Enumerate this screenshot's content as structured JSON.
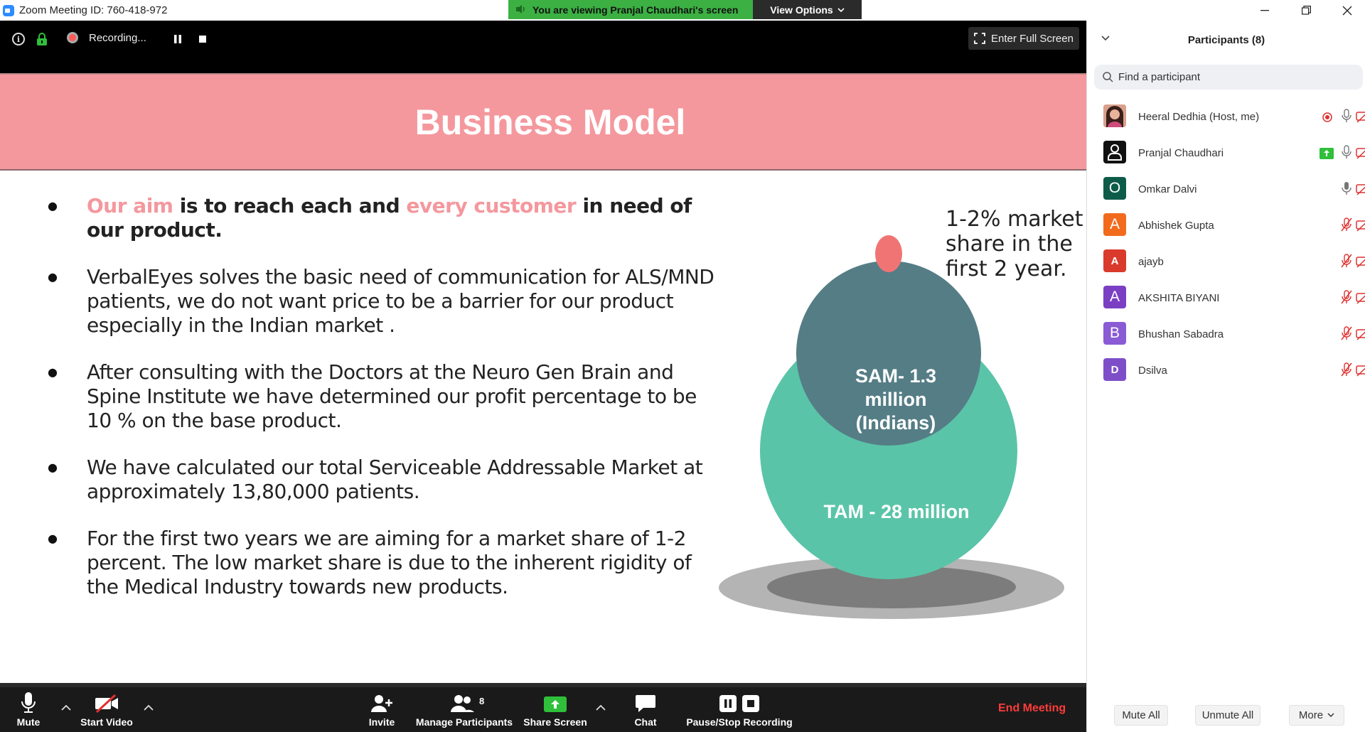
{
  "window": {
    "title": "Zoom Meeting ID: 760-418-972"
  },
  "banner": {
    "viewing_text": "You are viewing Pranjal Chaudhari's screen",
    "view_options": "View Options"
  },
  "topbar": {
    "recording_text": "Recording...",
    "fullscreen_label": "Enter Full Screen"
  },
  "slide": {
    "title": "Business Model",
    "bullet1": {
      "pink_a": "Our aim",
      "text_a": " is to reach each and ",
      "pink_b": "every customer",
      "text_b": " in need of our product."
    },
    "bullet2": "VerbalEyes solves the basic need of communication for ALS/MND patients, we do not want price to be a barrier for our product especially in the Indian market .",
    "bullet3": "After consulting with the Doctors at the Neuro Gen Brain and Spine Institute we have determined our profit percentage to be 10 % on the base product.",
    "bullet4": "We have calculated our total Serviceable Addressable Market at approximately 13,80,000 patients.",
    "bullet5": "For the first two years we are aiming for a market share of 1-2 percent. The low market share is due to the inherent rigidity of the Medical Industry towards new products.",
    "venn": {
      "market_share": "1-2% market share in the first 2 year.",
      "sam_line1": "SAM- 1.3",
      "sam_line2": "million",
      "sam_line3": "(Indians)",
      "tam": "TAM - 28 million"
    }
  },
  "toolbar": {
    "mute": "Mute",
    "start_video": "Start Video",
    "invite": "Invite",
    "manage_participants": "Manage Participants",
    "participant_count": "8",
    "share_screen": "Share Screen",
    "chat": "Chat",
    "pause_stop_recording": "Pause/Stop Recording",
    "end_meeting": "End Meeting"
  },
  "participants_panel": {
    "title": "Participants (8)",
    "search_placeholder": "Find a participant",
    "participants": [
      {
        "name": "Heeral Dedhia (Host, me)",
        "avatar": "photo",
        "color": "#c98a7a",
        "recording": true,
        "mic": "on",
        "video": "off"
      },
      {
        "name": "Pranjal Chaudhari",
        "avatar": "person-icon",
        "color": "#111111",
        "sharing": true,
        "mic": "on",
        "video": "off"
      },
      {
        "name": "Omkar Dalvi",
        "avatar": "O",
        "color": "#0d5c4a",
        "mic": "on",
        "video": "off"
      },
      {
        "name": "Abhishek Gupta",
        "avatar": "A",
        "color": "#f26b1d",
        "mic": "muted",
        "video": "off"
      },
      {
        "name": "ajayb",
        "avatar": "A",
        "color": "#d93a2b",
        "mic": "muted",
        "video": "off"
      },
      {
        "name": "AKSHITA BIYANI",
        "avatar": "A",
        "color": "#7b3fc4",
        "mic": "muted",
        "video": "off"
      },
      {
        "name": "Bhushan Sabadra",
        "avatar": "B",
        "color": "#8a5bd4",
        "mic": "muted",
        "video": "off"
      },
      {
        "name": "Dsilva",
        "avatar": "D",
        "color": "#7e4ec9",
        "mic": "muted",
        "video": "off"
      }
    ],
    "mute_all": "Mute All",
    "unmute_all": "Unmute All",
    "more": "More"
  },
  "colors": {
    "accent_pink": "#f4989e",
    "banner_green": "#3cb043",
    "end_red": "#ff3b3b",
    "sam_circle": "#557d86",
    "tam_circle": "#5ac4a8",
    "dot": "#f07474"
  }
}
